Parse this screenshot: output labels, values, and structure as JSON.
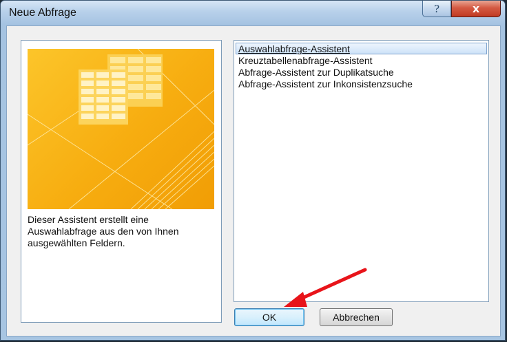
{
  "window": {
    "title": "Neue Abfrage",
    "help_glyph": "?",
    "close_glyph": "x"
  },
  "preview": {
    "description": "Dieser Assistent erstellt eine Auswahlabfrage aus den von Ihnen ausgewählten Feldern."
  },
  "wizard_list": {
    "items": [
      {
        "label": "Auswahlabfrage-Assistent",
        "selected": true
      },
      {
        "label": "Kreuztabellenabfrage-Assistent",
        "selected": false
      },
      {
        "label": "Abfrage-Assistent zur Duplikatsuche",
        "selected": false
      },
      {
        "label": "Abfrage-Assistent zur Inkonsistenzsuche",
        "selected": false
      }
    ]
  },
  "buttons": {
    "ok_label": "OK",
    "cancel_label": "Abbrechen"
  },
  "colors": {
    "art_yellow": "#f9b61a",
    "selection": "#cde2f8",
    "annotation_arrow": "#e8141a"
  },
  "icons": {
    "art": "table-grid-illustration",
    "annotation": "red-arrow-pointer"
  }
}
